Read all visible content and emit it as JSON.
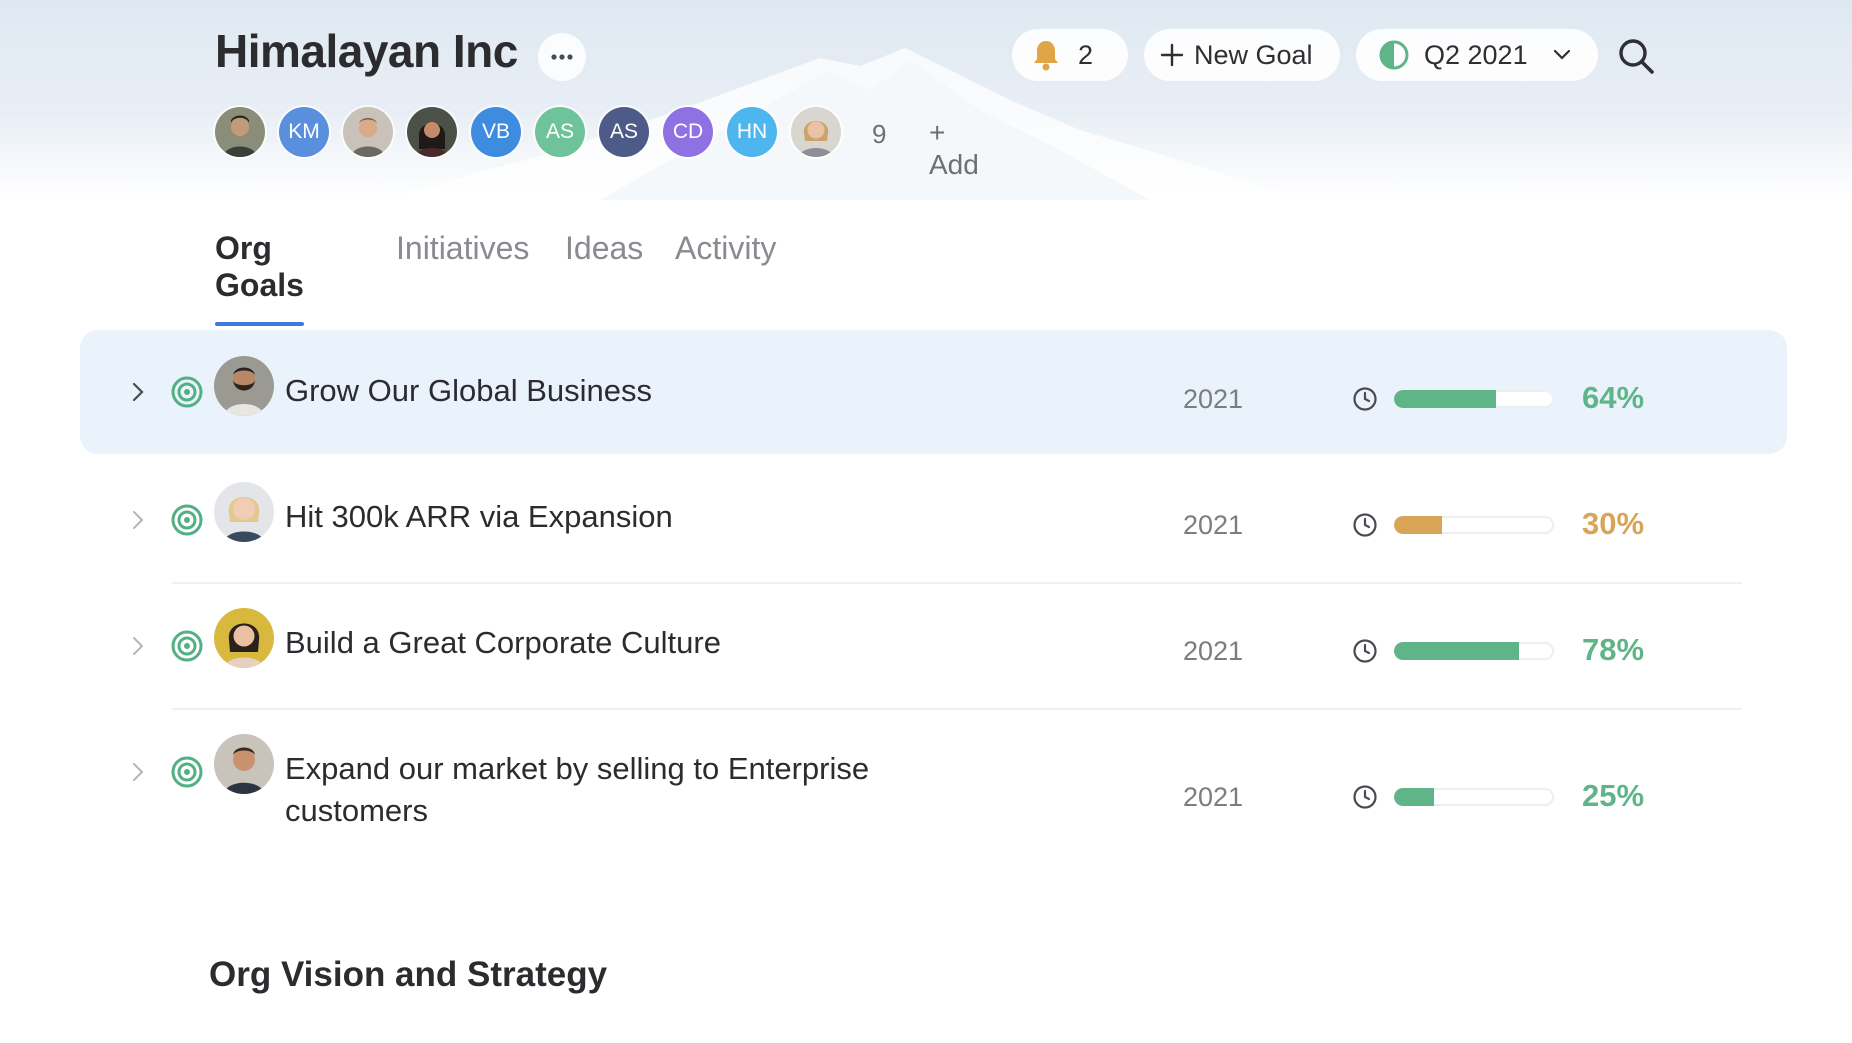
{
  "header": {
    "org_name": "Himalayan Inc",
    "notifications": {
      "count": "2",
      "icon": "bell-icon",
      "icon_color": "#e0a547"
    },
    "new_goal_label": "New Goal",
    "quarter": {
      "label": "Q2 2021",
      "icon": "half-circle-icon",
      "icon_color": "#5fb587"
    },
    "search_icon": "search-icon"
  },
  "members": {
    "avatars": [
      {
        "type": "photo",
        "initials": ""
      },
      {
        "type": "initials",
        "initials": "KM",
        "color": "#5a8fde"
      },
      {
        "type": "photo",
        "initials": ""
      },
      {
        "type": "photo",
        "initials": ""
      },
      {
        "type": "initials",
        "initials": "VB",
        "color": "#3d8ce0"
      },
      {
        "type": "initials",
        "initials": "AS",
        "color": "#6fc39a"
      },
      {
        "type": "initials",
        "initials": "AS",
        "color": "#4e5a88"
      },
      {
        "type": "initials",
        "initials": "CD",
        "color": "#8f71e4"
      },
      {
        "type": "initials",
        "initials": "HN",
        "color": "#4eb6ef"
      },
      {
        "type": "photo",
        "initials": ""
      }
    ],
    "more_count": "9",
    "add_label": "+ Add"
  },
  "tabs": [
    {
      "label": "Org Goals",
      "active": true
    },
    {
      "label": "Initiatives",
      "active": false
    },
    {
      "label": "Ideas",
      "active": false
    },
    {
      "label": "Activity",
      "active": false
    }
  ],
  "goals": [
    {
      "title": "Grow Our Global Business",
      "year": "2021",
      "progress": 0.64,
      "progress_label": "64%",
      "color": "#5fb587",
      "selected": true
    },
    {
      "title": "Hit 300k ARR via Expansion",
      "year": "2021",
      "progress": 0.3,
      "progress_label": "30%",
      "color": "#d8a455",
      "selected": false
    },
    {
      "title": "Build a Great Corporate Culture",
      "year": "2021",
      "progress": 0.78,
      "progress_label": "78%",
      "color": "#5fb587",
      "selected": false
    },
    {
      "title": "Expand our market by selling to Enterprise customers",
      "year": "2021",
      "progress": 0.25,
      "progress_label": "25%",
      "color": "#5fb587",
      "selected": false
    }
  ],
  "vision_section_title": "Org Vision and Strategy"
}
